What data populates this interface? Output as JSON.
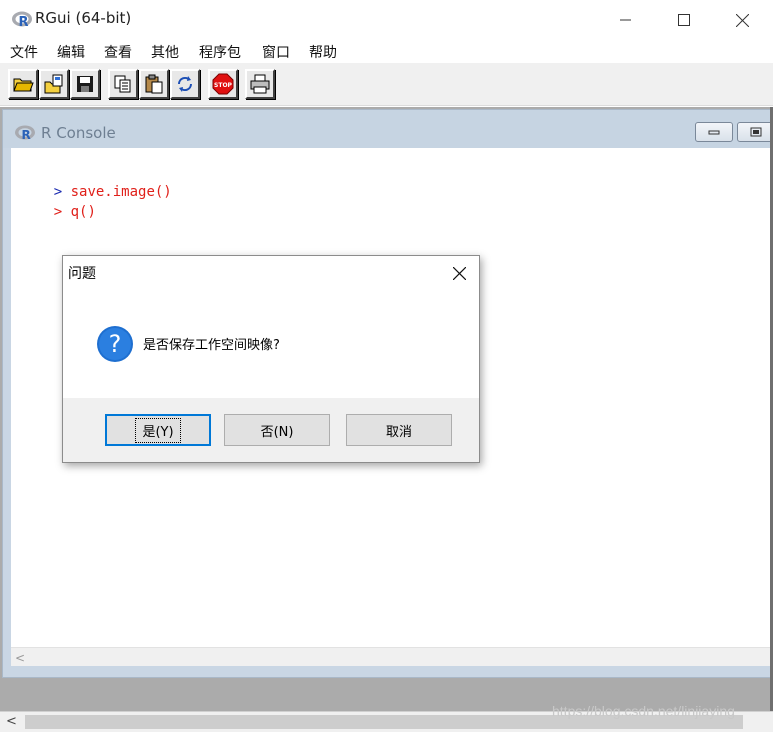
{
  "window": {
    "title": "RGui (64-bit)",
    "minimize": "—",
    "maximize": "☐",
    "close": "✕"
  },
  "menu": [
    "文件",
    "编辑",
    "查看",
    "其他",
    "程序包",
    "窗口",
    "帮助"
  ],
  "toolbar": {
    "buttons": [
      "open-script",
      "load-workspace",
      "save-workspace",
      "copy",
      "paste",
      "copy-paste",
      "stop",
      "print"
    ],
    "stop_label": "STOP"
  },
  "console": {
    "title": "R Console",
    "lines": [
      {
        "prompt": ">",
        "code": "save.image()"
      },
      {
        "prompt": ">",
        "code": "q()"
      }
    ]
  },
  "dialog": {
    "title": "问题",
    "message": "是否保存工作空间映像?",
    "buttons": {
      "yes": "是(Y)",
      "no": "否(N)",
      "cancel": "取消"
    }
  },
  "scroll": {
    "left_arrow": "<"
  },
  "watermark": "https://blog.csdn.net/linjiaying",
  "colors": {
    "prompt": "#1b2bb0",
    "code": "#e0201a",
    "accent": "#0078d7"
  }
}
